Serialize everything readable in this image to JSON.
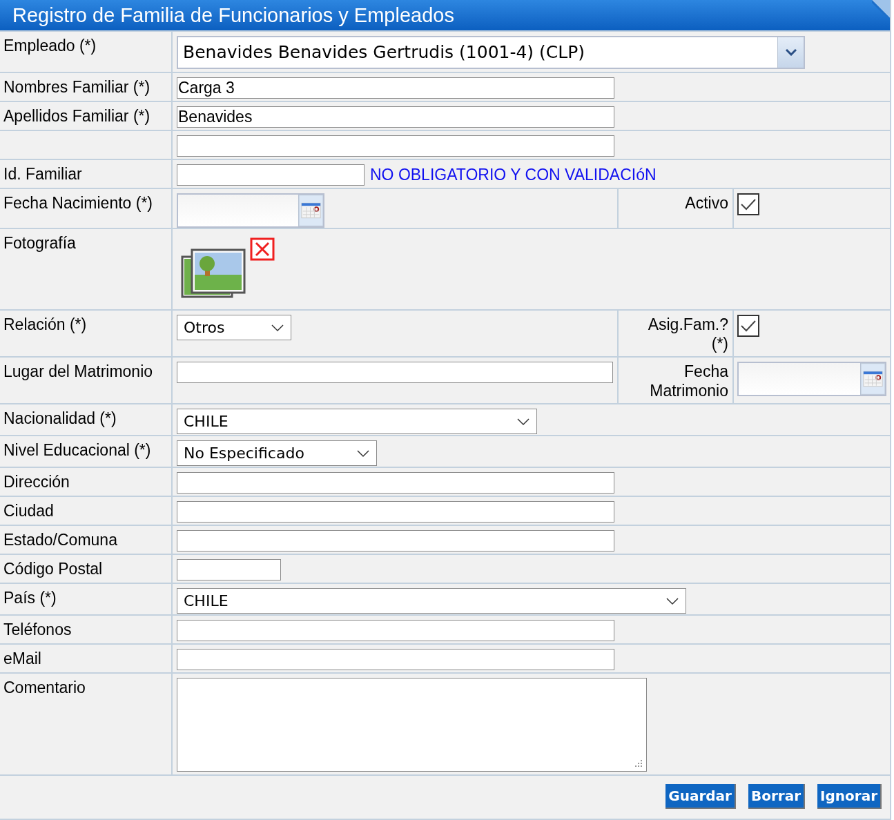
{
  "window": {
    "title": "Registro de Familia de Funcionarios y Empleados"
  },
  "rows": [
    {
      "kind": "combo",
      "label": "Empleado (*)",
      "value": "Benavides Benavides Gertrudis  (1001-4) (CLP)"
    },
    {
      "kind": "text",
      "label": "Nombres Familiar (*)",
      "value": "Carga 3"
    },
    {
      "kind": "text",
      "label": "Apellidos Familiar (*)",
      "value": "Benavides"
    },
    {
      "kind": "text"
    },
    {
      "kind": "id",
      "label": "Id. Familiar",
      "note": "NO OBLIGATORIO Y CON VALIDACIóN"
    },
    {
      "kind": "date",
      "label": "Fecha Nacimiento (*)",
      "side": {
        "kind": "check",
        "label": "Activo",
        "checked": true
      }
    },
    {
      "kind": "photo",
      "label": "Fotografía"
    },
    {
      "kind": "select",
      "label": "Relación (*)",
      "value": "Otros",
      "side": {
        "kind": "check",
        "label": "Asig.Fam.? (*)",
        "checked": true
      }
    },
    {
      "kind": "text",
      "label": "Lugar del Matrimonio",
      "side": {
        "kind": "date",
        "label": "Fecha Matrimonio"
      }
    },
    {
      "kind": "select",
      "label": "Nacionalidad (*)",
      "value": "CHILE"
    },
    {
      "kind": "select",
      "label": "Nivel Educacional (*)",
      "value": "No Especificado"
    },
    {
      "kind": "text",
      "label": "Dirección"
    },
    {
      "kind": "text",
      "label": "Ciudad"
    },
    {
      "kind": "text",
      "label": "Estado/Comuna"
    },
    {
      "kind": "postal",
      "label": "Código Postal"
    },
    {
      "kind": "select",
      "label": "País (*)",
      "value": "CHILE"
    },
    {
      "kind": "text",
      "label": "Teléfonos"
    },
    {
      "kind": "text",
      "label": "eMail"
    },
    {
      "kind": "textarea",
      "label": "Comentario"
    }
  ],
  "buttons": [
    "Guardar",
    "Borrar",
    "Ignorar"
  ]
}
